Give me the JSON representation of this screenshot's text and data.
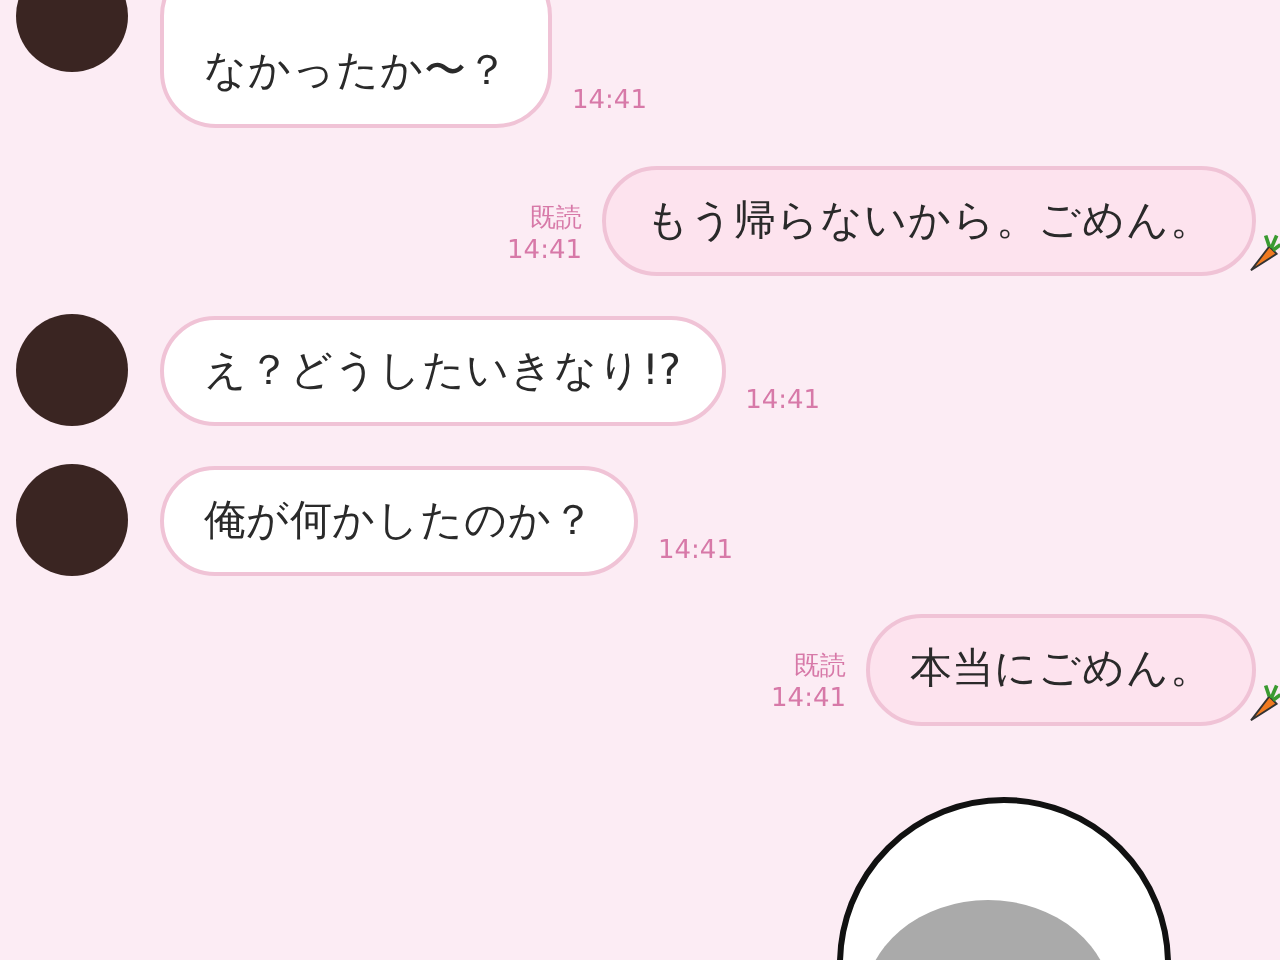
{
  "messages": [
    {
      "kind": "received",
      "text": "なかったか〜？",
      "time": "14:41"
    },
    {
      "kind": "sent",
      "text": "もう帰らないから。ごめん。",
      "read_label": "既読",
      "time": "14:41"
    },
    {
      "kind": "received",
      "text": "え？どうしたいきなり!?",
      "time": "14:41"
    },
    {
      "kind": "received",
      "text": "俺が何かしたのか？",
      "time": "14:41"
    },
    {
      "kind": "sent",
      "text": "本当にごめん。",
      "read_label": "既読",
      "time": "14:41"
    }
  ]
}
